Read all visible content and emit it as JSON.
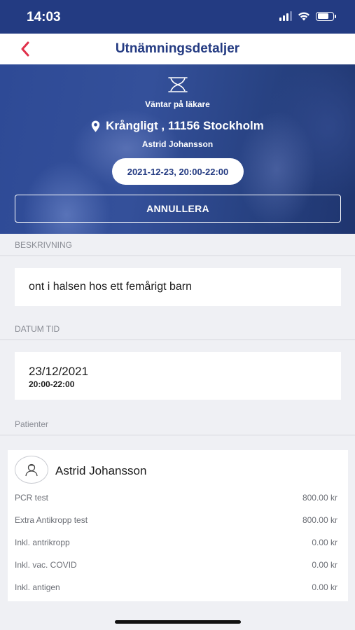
{
  "status_bar": {
    "time": "14:03",
    "battery_level": 0.75
  },
  "nav": {
    "title": "Utnämningsdetaljer",
    "back_icon": "chevron-left-icon",
    "accent_color": "#e0304a"
  },
  "hero": {
    "status": "Väntar på läkare",
    "location": "Krångligt , 11156 Stockholm",
    "patient_name": "Astrid Johansson",
    "time_slot": "2021-12-23, 20:00-22:00",
    "cancel_label": "ANNULLERA"
  },
  "description": {
    "label": "BESKRIVNING",
    "text": "ont i halsen hos ett femårigt barn"
  },
  "datetime": {
    "label": "DATUM TID",
    "date": "23/12/2021",
    "time": "20:00-22:00"
  },
  "patients": {
    "label": "Patienter",
    "name": "Astrid Johansson",
    "items": [
      {
        "name": "PCR test",
        "price": "800.00 kr"
      },
      {
        "name": "Extra Antikropp test",
        "price": "800.00 kr"
      },
      {
        "name": "Inkl. antrikropp",
        "price": "0.00 kr"
      },
      {
        "name": "Inkl. vac. COVID",
        "price": "0.00 kr"
      },
      {
        "name": "Inkl. antigen",
        "price": "0.00 kr"
      }
    ]
  },
  "colors": {
    "brand_blue": "#233b82",
    "background": "#eff0f4"
  }
}
